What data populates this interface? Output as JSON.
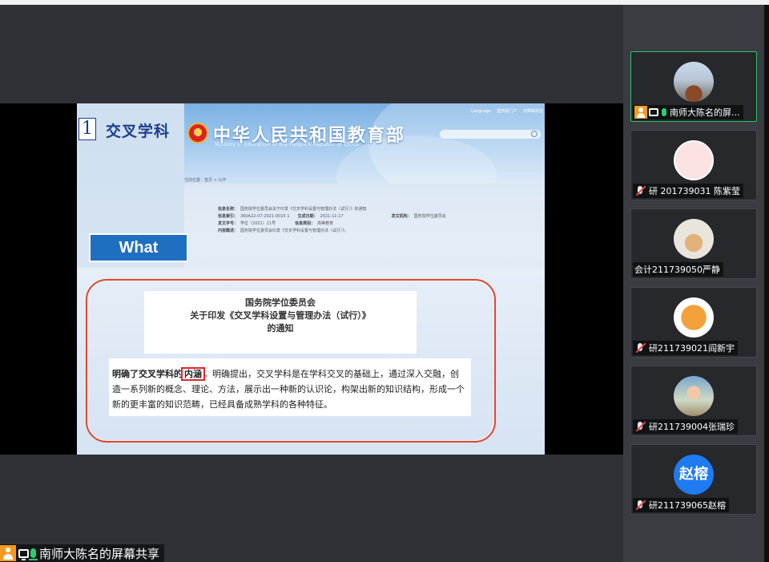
{
  "slide": {
    "number": "1",
    "title": "交叉学科",
    "site": {
      "title": "中华人民共和国教育部",
      "subtitle": "Ministry of Education of the People's Republic of China",
      "links": [
        "Language",
        "国务院门户",
        "无障碍浏览"
      ]
    },
    "breadcrumb": "当前位置：首页 > 公开",
    "info": {
      "row1_key": "信息名称：",
      "row1_val": "国务院学位委员会关于印发《交叉学科设置与管理办法（试行）》的通知",
      "row2_key": "信息索引：",
      "row2_val": "360A22-07-2021-0015-1",
      "row2_key2": "生成日期：",
      "row2_val2": "2021-11-17",
      "row2_key3": "发文机构：",
      "row2_val3": "国务院学位委员会",
      "row3_key": "发文字号：",
      "row3_val": "学位〔2021〕21号",
      "row3_key2": "信息类别：",
      "row3_val2": "高等教育",
      "row4_key": "内容概述：",
      "row4_val": "国务院学位委员会印发《交叉学科设置与管理办法（试行）》。"
    },
    "what_label": "What",
    "notice": {
      "line1": "国务院学位委员会",
      "line2": "关于印发《交叉学科设置与管理办法（试行）》",
      "line3": "的通知"
    },
    "body": {
      "lead": "明确了交叉学科的",
      "highlight": "内涵",
      "rest": "。明确提出，交叉学科是在学科交叉的基础上，通过深入交融，创造一系列新的概念、理论、方法，展示出一种新的认识论，构架出新的知识结构，形成一个新的更丰富的知识范畴，已经具备成熟学科的各种特征。"
    }
  },
  "share_label": "南师大陈名的屏幕共享",
  "participants": [
    {
      "name": "南师大陈名的屏...",
      "avatar": "photo-avatar",
      "active": true
    },
    {
      "name": "研 201739031 陈紫莹",
      "avatar": "pig-avatar",
      "active": false
    },
    {
      "name": "会计211739050严静",
      "avatar": "dog-avatar",
      "active": false
    },
    {
      "name": "研211739021阎新宇",
      "avatar": "tiger-avatar",
      "active": false
    },
    {
      "name": "研211739004张瑞珍",
      "avatar": "photo-avatar",
      "active": false
    },
    {
      "name": "研211739065赵榕",
      "avatar_text": "赵榕",
      "active": false
    }
  ],
  "colors": {
    "accent_green": "#2ec26a",
    "frame_red": "#e2462b",
    "what_blue": "#1f6fc1",
    "avatar_blue": "#1f7bf2",
    "share_orange": "#f39a1f"
  }
}
